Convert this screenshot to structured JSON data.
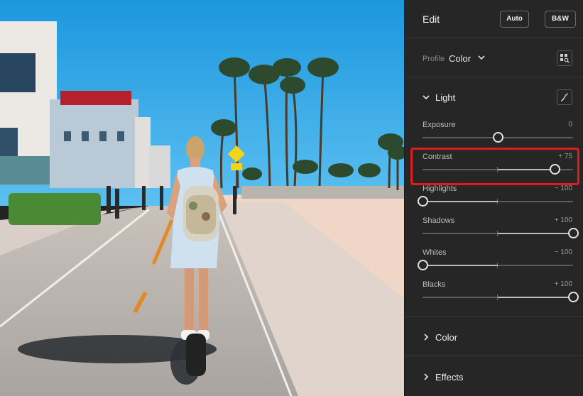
{
  "panel": {
    "title": "Edit",
    "auto_label": "Auto",
    "bw_label": "B&W",
    "profile": {
      "label": "Profile",
      "value": "Color"
    },
    "light": {
      "title": "Light",
      "sliders": [
        {
          "name": "Exposure",
          "value_text": "0",
          "value": 0
        },
        {
          "name": "Contrast",
          "value_text": "+ 75",
          "value": 75
        },
        {
          "name": "Highlights",
          "value_text": "− 100",
          "value": -100
        },
        {
          "name": "Shadows",
          "value_text": "+ 100",
          "value": 100
        },
        {
          "name": "Whites",
          "value_text": "− 100",
          "value": -100
        },
        {
          "name": "Blacks",
          "value_text": "+ 100",
          "value": 100
        }
      ]
    },
    "color_title": "Color",
    "effects_title": "Effects"
  },
  "icons": {
    "profile_chevron": "chevron-down-icon",
    "profile_browser": "profile-browser-icon",
    "light_chevron": "chevron-down-icon",
    "tone_curve": "tone-curve-icon",
    "color_chevron": "chevron-right-icon",
    "effects_chevron": "chevron-right-icon"
  },
  "colors": {
    "highlight": "#e11b1b",
    "panel_bg": "#262626",
    "sky": "#1f9be0"
  }
}
